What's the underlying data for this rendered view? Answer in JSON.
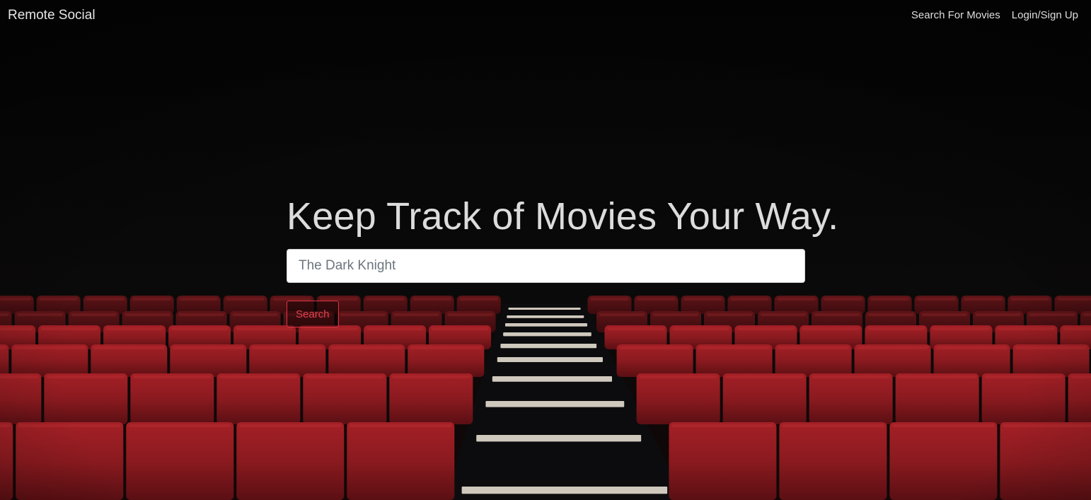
{
  "navbar": {
    "brand": "Remote Social",
    "links": [
      {
        "label": "Search For Movies"
      },
      {
        "label": "Login/Sign Up"
      }
    ]
  },
  "hero": {
    "title": "Keep Track of Movies Your Way.",
    "search": {
      "placeholder": "The Dark Knight",
      "value": ""
    },
    "button_label": "Search"
  },
  "colors": {
    "accent": "#dc3545",
    "seat": "#8e1b20",
    "background": "#000000"
  }
}
